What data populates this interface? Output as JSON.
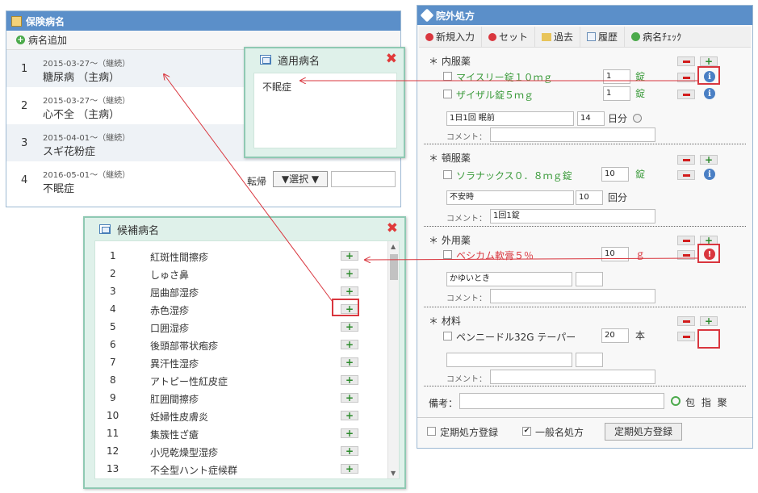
{
  "left_panel": {
    "title": "保険病名",
    "add_label": "病名追加",
    "rows": [
      {
        "no": "1",
        "date": "2015-03-27～（継続）",
        "name": "糖尿病 （主病）"
      },
      {
        "no": "2",
        "date": "2015-03-27～（継続）",
        "name": "心不全 （主病）"
      },
      {
        "no": "3",
        "date": "2015-04-01～（継続）",
        "name": "スギ花粉症"
      },
      {
        "no": "4",
        "date": "2016-05-01～（継続）",
        "name": "不眠症"
      }
    ],
    "tenki_label": "転帰",
    "select_label": "▼選択 ▼"
  },
  "applied_popup": {
    "title": "適用病名",
    "value": "不眠症",
    "close": "✖"
  },
  "candidate_popup": {
    "title": "候補病名",
    "close": "✖",
    "items": [
      {
        "no": "1",
        "name": "紅斑性間擦疹"
      },
      {
        "no": "2",
        "name": "しゅさ鼻"
      },
      {
        "no": "3",
        "name": "屈曲部湿疹"
      },
      {
        "no": "4",
        "name": "赤色湿疹"
      },
      {
        "no": "5",
        "name": "口囲湿疹"
      },
      {
        "no": "6",
        "name": "後頭部帯状疱疹"
      },
      {
        "no": "7",
        "name": "異汗性湿疹"
      },
      {
        "no": "8",
        "name": "アトピー性紅皮症"
      },
      {
        "no": "9",
        "name": "肛囲間擦疹"
      },
      {
        "no": "10",
        "name": "妊婦性皮膚炎"
      },
      {
        "no": "11",
        "name": "集簇性ざ瘡"
      },
      {
        "no": "12",
        "name": "小児乾燥型湿疹"
      },
      {
        "no": "13",
        "name": "不全型ハント症候群"
      }
    ]
  },
  "right_panel": {
    "title": "院外処方",
    "toolbar": {
      "new": "新規入力",
      "set": "セット",
      "past": "過去",
      "history": "履歴",
      "check": "病名ﾁｪｯｸ"
    },
    "sections": {
      "naifuku": {
        "label": "＊ 内服薬",
        "drugs": [
          {
            "name": "マイスリー錠１０ｍｇ",
            "qty": "1",
            "unit": "錠"
          },
          {
            "name": "ザイザル錠５ｍｇ",
            "qty": "1",
            "unit": "錠"
          }
        ],
        "usage": "1日1回 眠前",
        "days": "14",
        "days_unit": "日分",
        "comment_label": "コメント："
      },
      "tonpuku": {
        "label": "＊ 頓服薬",
        "drugs": [
          {
            "name": "ソラナックス０．８ｍｇ錠",
            "qty": "10",
            "unit": "錠"
          }
        ],
        "usage": "不安時",
        "times": "10",
        "times_unit": "回分",
        "comment_label": "コメント：",
        "comment": "1回1錠"
      },
      "gaiyou": {
        "label": "＊ 外用薬",
        "drugs": [
          {
            "name": "ベシカム軟膏５％",
            "qty": "10",
            "unit": "ｇ"
          }
        ],
        "usage": "かゆいとき",
        "comment_label": "コメント："
      },
      "zairyo": {
        "label": "＊ 材料",
        "drugs": [
          {
            "name": "ペンニードル32G テーパー",
            "qty": "20",
            "unit": "本"
          }
        ],
        "comment_label": "コメント："
      }
    },
    "bikou_label": "備考：",
    "bikou_links": "包 指 聚",
    "footer": {
      "teiki_check": "定期処方登録",
      "ippan_check": "一般名処方",
      "teiki_btn": "定期処方登録"
    }
  }
}
